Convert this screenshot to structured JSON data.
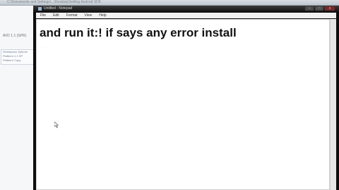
{
  "browser": {
    "title_text": "C:\\Documents and Settings\\...\\Desktop\\Setting Android SDK"
  },
  "left_pane": {
    "line1": "AVD 1.1 (SPR)",
    "box_lines": [
      "Workspace Options",
      "Platform 1.1 SP",
      "Platform Copy"
    ]
  },
  "window": {
    "title": "Untitled - Notepad",
    "controls": {
      "minimize": "–",
      "maximize": "□",
      "close": "x"
    },
    "menu": [
      "File",
      "Edit",
      "Format",
      "View",
      "Help"
    ]
  },
  "editor": {
    "text": "and run it:! if says any error install",
    "subtext": ". . . ."
  }
}
